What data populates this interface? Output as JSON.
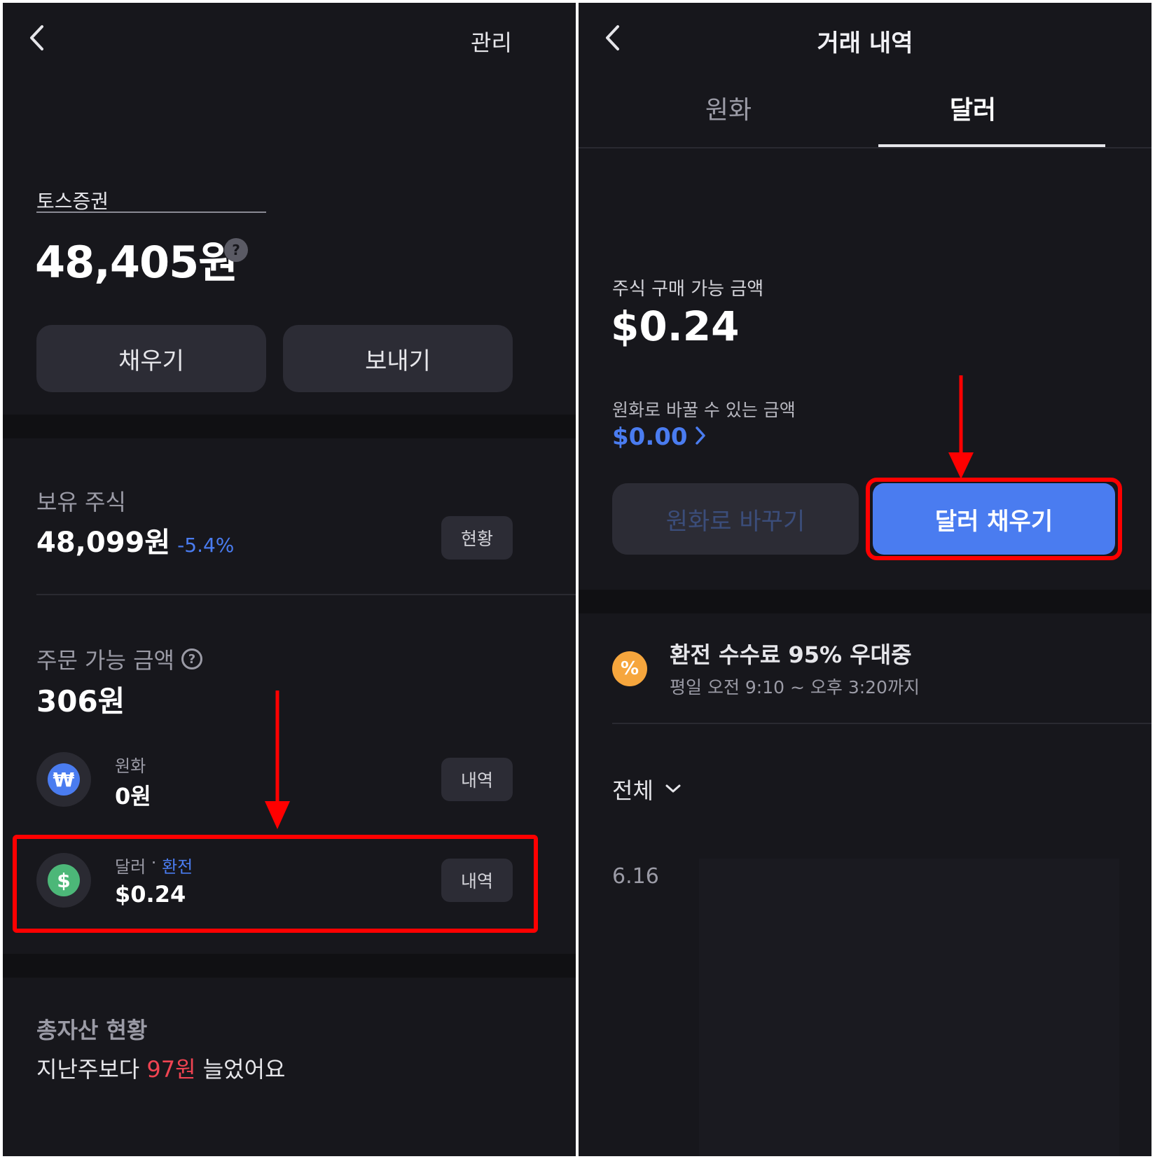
{
  "left": {
    "manage_label": "관리",
    "account_name": "토스증권",
    "total_amount": "48,405원",
    "help_glyph": "?",
    "fill_button": "채우기",
    "send_button": "보내기",
    "holdings": {
      "title": "보유 주식",
      "amount": "48,099원",
      "change": "-5.4%",
      "status_button": "현황"
    },
    "orderable": {
      "title": "주문 가능 금액",
      "help_glyph": "?",
      "amount": "306원"
    },
    "krw": {
      "icon_glyph": "₩",
      "label": "원화",
      "amount": "0원",
      "history_button": "내역"
    },
    "usd": {
      "icon_glyph": "$",
      "label": "달러",
      "separator": " · ",
      "exchange_link": "환전",
      "amount": "$0.24",
      "history_button": "내역"
    },
    "total_assets": {
      "title": "총자산 현황",
      "text_before": "지난주보다 ",
      "highlight": "97원",
      "text_after": " 늘었어요"
    }
  },
  "right": {
    "title": "거래 내역",
    "tabs": [
      {
        "label": "원화",
        "active": false
      },
      {
        "label": "달러",
        "active": true
      }
    ],
    "buyable_label": "주식 구매 가능 금액",
    "buyable_amount": "$0.24",
    "convertible_label": "원화로 바꿀 수 있는 금액",
    "convertible_amount": "$0.00",
    "convert_button": "원화로 바꾸기",
    "fill_dollar_button": "달러 채우기",
    "promo": {
      "icon_glyph": "%",
      "title": "환전 수수료 95% 우대중",
      "subtitle": "평일 오전 9:10 ~ 오후 3:20까지"
    },
    "filter_label": "전체",
    "date_label": "6.16"
  },
  "colors": {
    "background": "#17171c",
    "button": "#2c2c35",
    "accent_blue": "#4a7cf0",
    "dollar_green": "#4cb778",
    "promo_orange": "#f6a63d",
    "increase_red": "#f04452",
    "annotation_red": "#ff0000"
  },
  "icons": {
    "back": "chevron-left-icon",
    "chevron_right": "chevron-right-icon",
    "chevron_down": "chevron-down-icon"
  }
}
